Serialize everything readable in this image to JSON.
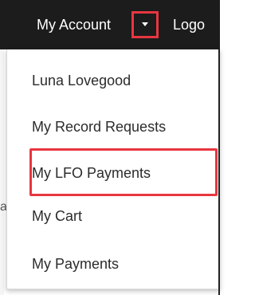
{
  "navbar": {
    "account_label": "My Account",
    "logout_label": "Logo"
  },
  "background": {
    "fragment_text": "a"
  },
  "dropdown": {
    "items": [
      {
        "label": "Luna Lovegood"
      },
      {
        "label": "My Record Requests"
      },
      {
        "label": "My LFO Payments"
      },
      {
        "label": "My Cart"
      },
      {
        "label": "My Payments"
      }
    ],
    "highlighted_item": "My Record Requests"
  },
  "colors": {
    "navbar_bg": "#1c1c1c",
    "highlight": "#e8363f",
    "menu_text": "#2b2b2b"
  },
  "icons": {
    "dropdown_toggle": "caret-down-icon"
  }
}
